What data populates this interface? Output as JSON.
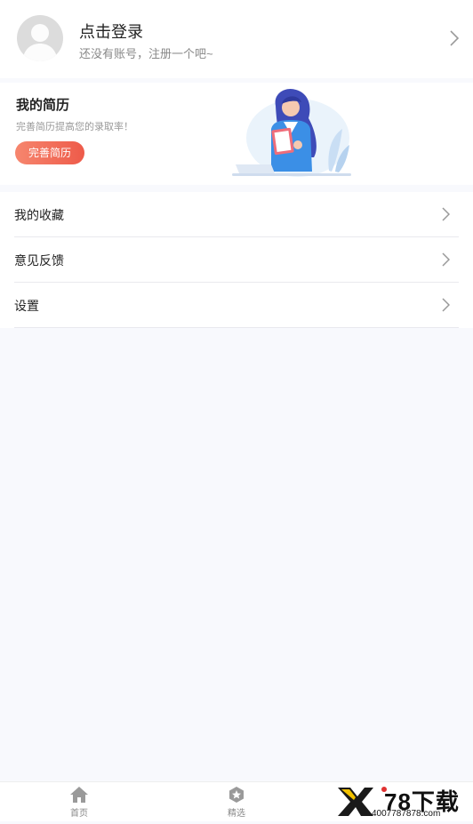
{
  "header": {
    "login_title": "点击登录",
    "login_subtitle": "还没有账号，注册一个吧~"
  },
  "resume": {
    "title": "我的简历",
    "subtitle": "完善简历提高您的录取率！",
    "button_label": "完善简历",
    "accent_color": "#ef6452"
  },
  "menu": {
    "items": [
      {
        "label": "我的收藏"
      },
      {
        "label": "意见反馈"
      },
      {
        "label": "设置"
      }
    ]
  },
  "tabbar": {
    "tabs": [
      {
        "label": "首页",
        "icon": "home-icon"
      },
      {
        "label": "精选",
        "icon": "star-badge-icon"
      }
    ]
  },
  "watermark": {
    "brand": "78下载",
    "url": "4007787878.com"
  }
}
